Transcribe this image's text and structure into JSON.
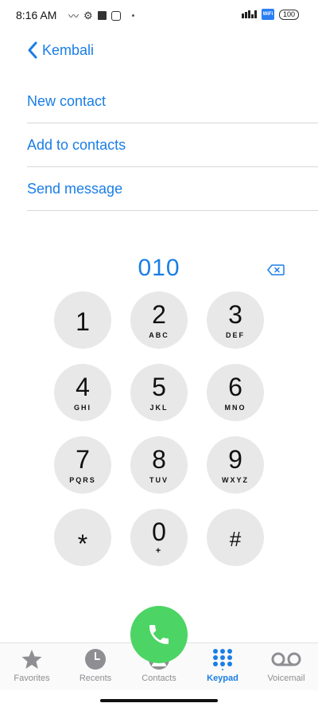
{
  "status_bar": {
    "time": "8:16 AM",
    "battery": "100",
    "wifi_label": "WiFi"
  },
  "header": {
    "back_label": "Kembali"
  },
  "actions": [
    {
      "label": "New contact"
    },
    {
      "label": "Add to contacts"
    },
    {
      "label": "Send message"
    }
  ],
  "dialed_number": "010",
  "keys": [
    {
      "digit": "1",
      "letters": ""
    },
    {
      "digit": "2",
      "letters": "ABC"
    },
    {
      "digit": "3",
      "letters": "DEF"
    },
    {
      "digit": "4",
      "letters": "GHI"
    },
    {
      "digit": "5",
      "letters": "JKL"
    },
    {
      "digit": "6",
      "letters": "MNO"
    },
    {
      "digit": "7",
      "letters": "PQRS"
    },
    {
      "digit": "8",
      "letters": "TUV"
    },
    {
      "digit": "9",
      "letters": "WXYZ"
    },
    {
      "digit": "*",
      "letters": ""
    },
    {
      "digit": "0",
      "letters": "+"
    },
    {
      "digit": "#",
      "letters": ""
    }
  ],
  "tabs": [
    {
      "label": "Favorites",
      "icon": "star-icon"
    },
    {
      "label": "Recents",
      "icon": "clock-icon"
    },
    {
      "label": "Contacts",
      "icon": "person-icon"
    },
    {
      "label": "Keypad",
      "icon": "keypad-icon",
      "active": true
    },
    {
      "label": "Voicemail",
      "icon": "voicemail-icon"
    }
  ],
  "colors": {
    "accent": "#1a7ee6",
    "call": "#4cd464",
    "key_bg": "#e8e8e8",
    "tab_inactive": "#8e8e93"
  }
}
